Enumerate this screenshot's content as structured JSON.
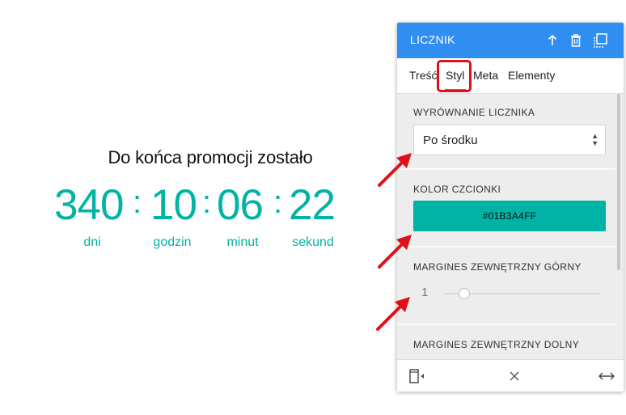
{
  "preview": {
    "title": "Do końca promocji zostało",
    "countdown": [
      {
        "value": "340",
        "unit": "dni"
      },
      {
        "value": "10",
        "unit": "godzin"
      },
      {
        "value": "06",
        "unit": "minut"
      },
      {
        "value": "22",
        "unit": "sekund"
      }
    ],
    "separator": ":",
    "accent_color": "#01B3A4"
  },
  "panel": {
    "title": "LICZNIK",
    "header_color": "#2f8ef0",
    "header_icons": [
      "arrow-up-icon",
      "trash-icon",
      "duplicate-icon"
    ],
    "tabs": [
      {
        "label": "Treść",
        "active": false
      },
      {
        "label": "Styl",
        "active": true
      },
      {
        "label": "Meta",
        "active": false
      },
      {
        "label": "Elementy",
        "active": false
      }
    ],
    "sections": {
      "alignment": {
        "label": "WYRÓWNANIE LICZNIKA",
        "value": "Po środku"
      },
      "font_color": {
        "label": "KOLOR CZCIONKI",
        "value": "#01B3A4FF"
      },
      "margin_top": {
        "label": "MARGINES ZEWNĘTRZNY GÓRNY",
        "value": "1"
      },
      "margin_bottom": {
        "label": "MARGINES ZEWNĘTRZNY DOLNY"
      }
    },
    "footer_icons": [
      "responsive-toggle-icon",
      "close-icon",
      "resize-horizontal-icon"
    ]
  },
  "annotation": {
    "highlight_color": "#e0101a",
    "arrow_count": 3
  }
}
